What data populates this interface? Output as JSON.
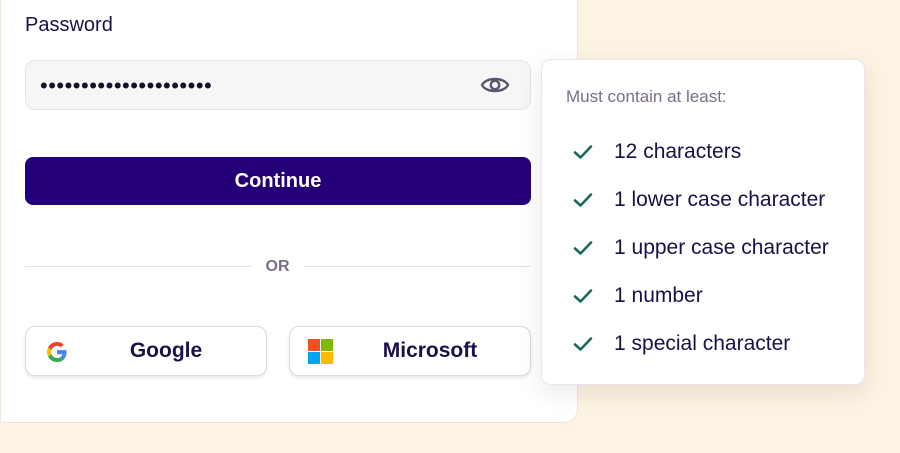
{
  "form": {
    "password_label": "Password",
    "password_value": "•••••••••••••••••••••",
    "continue_label": "Continue",
    "divider_text": "OR"
  },
  "social": {
    "google_label": "Google",
    "microsoft_label": "Microsoft"
  },
  "requirements": {
    "title": "Must contain at least:",
    "items": [
      {
        "label": "12 characters",
        "met": true
      },
      {
        "label": "1 lower case character",
        "met": true
      },
      {
        "label": "1 upper case character",
        "met": true
      },
      {
        "label": "1 number",
        "met": true
      },
      {
        "label": "1 special character",
        "met": true
      }
    ]
  },
  "icons": {
    "eye": "eye-icon",
    "check": "check-icon",
    "google": "google-icon",
    "microsoft": "microsoft-icon"
  },
  "colors": {
    "primary": "#240078",
    "check": "#1b6b5a",
    "page_background": "#fdf3e3",
    "text": "#1c0f4a",
    "muted_text": "#7a6f86"
  }
}
